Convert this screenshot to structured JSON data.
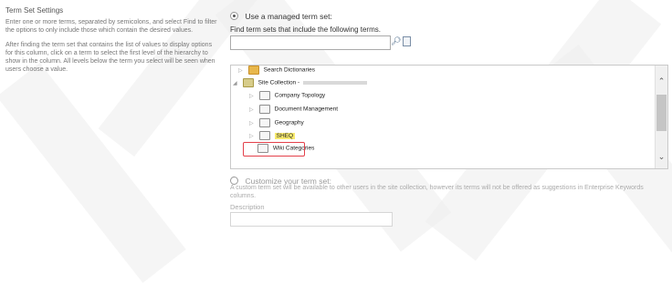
{
  "left": {
    "title": "Term Set Settings",
    "para1": "Enter one or more terms, separated by semicolons, and select Find to filter the options to only include those which contain the desired values.",
    "para2": "After finding the term set that contains the list of values to display options for this column, click on a term to select the first level of the hierarchy to show in the column. All levels below the term you select will be seen when users choose a value."
  },
  "managed": {
    "radio_label": "Use a managed term set:",
    "hint": "Find term sets that include the following terms.",
    "search_value": "",
    "icons": [
      "find-icon",
      "browse-icon"
    ]
  },
  "tree": {
    "nodes": [
      {
        "label": "Search Dictionaries",
        "icon": "folder-icon"
      },
      {
        "label": "Site Collection - ",
        "icon": "site-collection-icon"
      },
      {
        "label": "Company Topology",
        "icon": "term-set-icon"
      },
      {
        "label": "Document Management",
        "icon": "term-set-icon"
      },
      {
        "label": "Geography",
        "icon": "term-set-icon"
      },
      {
        "label": "SHEQ",
        "icon": "term-set-icon",
        "selected": true
      },
      {
        "label": "Wiki Categories",
        "icon": "term-set-icon"
      }
    ]
  },
  "custom": {
    "radio_label": "Customize your term set:",
    "description": "A custom term set will be available to other users in the site collection, however its terms will not be offered as suggestions in Enterprise Keywords columns.",
    "desc_label": "Description",
    "desc_value": ""
  },
  "colors": {
    "selection_highlight": "#f7e96d",
    "callout_border": "#e3404a"
  }
}
